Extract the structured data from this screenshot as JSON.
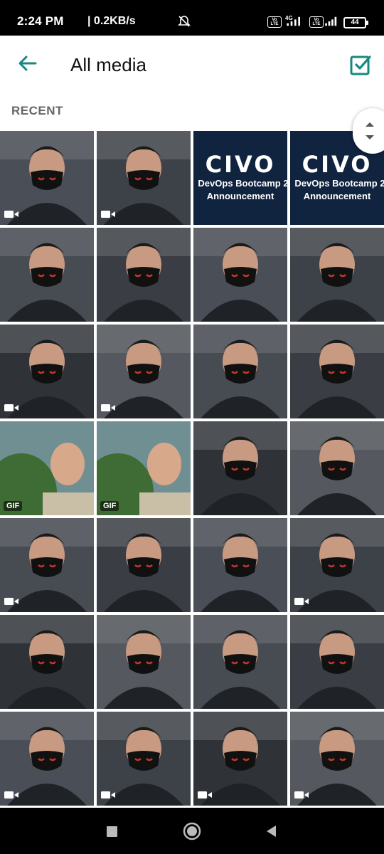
{
  "status": {
    "time": "2:24 PM",
    "net": "| 0.2KB/s",
    "volte1": "Vo LTE",
    "net_type": "4G",
    "volte2": "Vo LTE",
    "battery": "44"
  },
  "appbar": {
    "title": "All media"
  },
  "section": {
    "label": "RECENT"
  },
  "civo": {
    "logo": "CIVO",
    "line1": "DevOps Bootcamp 2",
    "line2": "Announcement"
  },
  "badges": {
    "gif": "GIF"
  },
  "colors": {
    "accent": "#16897e",
    "civo_bg": "#10233f"
  },
  "tiles": [
    {
      "kind": "photo",
      "badge": "video"
    },
    {
      "kind": "photo",
      "badge": "video"
    },
    {
      "kind": "civo",
      "badge": ""
    },
    {
      "kind": "civo",
      "badge": ""
    },
    {
      "kind": "photo",
      "badge": ""
    },
    {
      "kind": "photo",
      "badge": ""
    },
    {
      "kind": "photo",
      "badge": ""
    },
    {
      "kind": "photo",
      "badge": ""
    },
    {
      "kind": "photo",
      "badge": "video"
    },
    {
      "kind": "photo",
      "badge": "video"
    },
    {
      "kind": "photo",
      "badge": ""
    },
    {
      "kind": "photo",
      "badge": ""
    },
    {
      "kind": "photo",
      "badge": "gif"
    },
    {
      "kind": "photo",
      "badge": "gif"
    },
    {
      "kind": "photo",
      "badge": ""
    },
    {
      "kind": "photo",
      "badge": ""
    },
    {
      "kind": "photo",
      "badge": "video"
    },
    {
      "kind": "photo",
      "badge": ""
    },
    {
      "kind": "photo",
      "badge": ""
    },
    {
      "kind": "photo",
      "badge": "video"
    },
    {
      "kind": "photo",
      "badge": ""
    },
    {
      "kind": "photo",
      "badge": ""
    },
    {
      "kind": "photo",
      "badge": ""
    },
    {
      "kind": "photo",
      "badge": ""
    },
    {
      "kind": "photo",
      "badge": "video"
    },
    {
      "kind": "photo",
      "badge": "video"
    },
    {
      "kind": "photo",
      "badge": "video"
    },
    {
      "kind": "photo",
      "badge": "video"
    }
  ]
}
